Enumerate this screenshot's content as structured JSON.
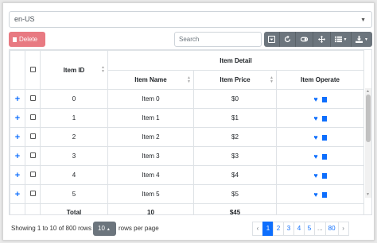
{
  "locale": {
    "value": "en-US"
  },
  "toolbar": {
    "delete_label": "Delete",
    "search_placeholder": "Search",
    "buttons": [
      "toggle-icon",
      "refresh-icon",
      "toggle-all-icon",
      "fullscreen-icon",
      "columns-icon",
      "export-icon"
    ]
  },
  "table": {
    "headers": {
      "item_id": "Item ID",
      "item_detail": "Item Detail",
      "item_name": "Item Name",
      "item_price": "Item Price",
      "item_operate": "Item Operate"
    },
    "rows": [
      {
        "id": "0",
        "name": "Item 0",
        "price": "$0"
      },
      {
        "id": "1",
        "name": "Item 1",
        "price": "$1"
      },
      {
        "id": "2",
        "name": "Item 2",
        "price": "$2"
      },
      {
        "id": "3",
        "name": "Item 3",
        "price": "$3"
      },
      {
        "id": "4",
        "name": "Item 4",
        "price": "$4"
      },
      {
        "id": "5",
        "name": "Item 5",
        "price": "$5"
      }
    ],
    "footer": {
      "label": "Total",
      "count": "10",
      "sum": "$45"
    }
  },
  "pagination": {
    "info": "Showing 1 to 10 of 800 rows",
    "page_size": "10",
    "rows_per_page": "rows per page",
    "prev": "‹",
    "pages": [
      "1",
      "2",
      "3",
      "4",
      "5",
      "...",
      "80"
    ],
    "next": "›",
    "active_page": "1"
  },
  "colors": {
    "primary": "#0d6efd",
    "danger": "#e87a82",
    "secondary": "#6c757d"
  }
}
